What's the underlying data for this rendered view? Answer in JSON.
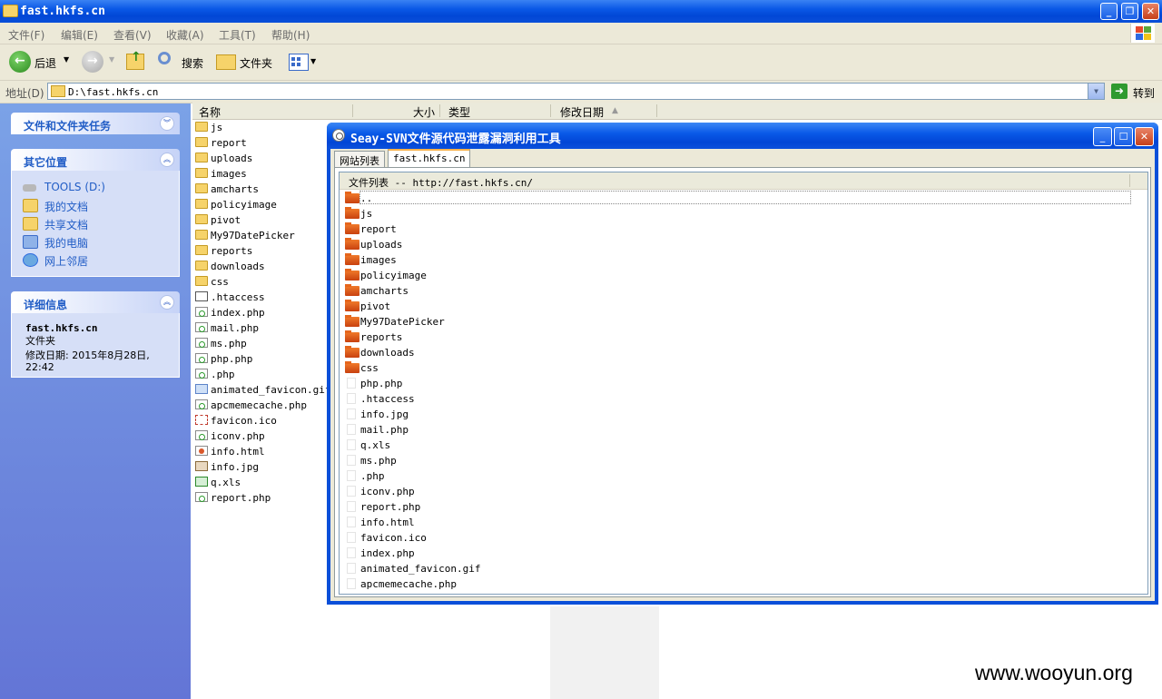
{
  "explorer": {
    "title": "fast.hkfs.cn",
    "menu": [
      "文件(F)",
      "编辑(E)",
      "查看(V)",
      "收藏(A)",
      "工具(T)",
      "帮助(H)"
    ],
    "toolbar": {
      "back": "后退",
      "search": "搜索",
      "folders": "文件夹"
    },
    "address": {
      "label": "地址(D)",
      "path": "D:\\fast.hkfs.cn",
      "go": "转到"
    },
    "columns": {
      "name": "名称",
      "size": "大小",
      "type": "类型",
      "modified": "修改日期"
    },
    "files": [
      {
        "name": "js",
        "icon": "folder-icon"
      },
      {
        "name": "report",
        "icon": "folder-icon"
      },
      {
        "name": "uploads",
        "icon": "folder-icon"
      },
      {
        "name": "images",
        "icon": "folder-icon"
      },
      {
        "name": "amcharts",
        "icon": "folder-icon"
      },
      {
        "name": "policyimage",
        "icon": "folder-icon"
      },
      {
        "name": "pivot",
        "icon": "folder-icon"
      },
      {
        "name": "My97DatePicker",
        "icon": "folder-icon"
      },
      {
        "name": "reports",
        "icon": "folder-icon"
      },
      {
        "name": "downloads",
        "icon": "folder-icon"
      },
      {
        "name": "css",
        "icon": "folder-icon"
      },
      {
        "name": ".htaccess",
        "icon": "htaccess-file-icon"
      },
      {
        "name": "index.php",
        "icon": "php-file-icon"
      },
      {
        "name": "mail.php",
        "icon": "php-file-icon"
      },
      {
        "name": "ms.php",
        "icon": "php-file-icon"
      },
      {
        "name": "php.php",
        "icon": "php-file-icon"
      },
      {
        "name": ".php",
        "icon": "php-file-icon"
      },
      {
        "name": "animated_favicon.gif",
        "icon": "gif-file-icon"
      },
      {
        "name": "apcmemecache.php",
        "icon": "php-file-icon"
      },
      {
        "name": "favicon.ico",
        "icon": "ico-file-icon"
      },
      {
        "name": "iconv.php",
        "icon": "php-file-icon"
      },
      {
        "name": "info.html",
        "icon": "html-file-icon"
      },
      {
        "name": "info.jpg",
        "icon": "jpg-file-icon"
      },
      {
        "name": "q.xls",
        "icon": "xls-file-icon"
      },
      {
        "name": "report.php",
        "icon": "php-file-icon"
      }
    ]
  },
  "taskpane": {
    "file_tasks": {
      "title": "文件和文件夹任务"
    },
    "other_places": {
      "title": "其它位置",
      "items": [
        {
          "label": "TOOLS (D:)",
          "icon": "drive-icon"
        },
        {
          "label": "我的文档",
          "icon": "my-documents-icon"
        },
        {
          "label": "共享文档",
          "icon": "shared-documents-icon"
        },
        {
          "label": "我的电脑",
          "icon": "my-computer-icon"
        },
        {
          "label": "网上邻居",
          "icon": "network-icon"
        }
      ]
    },
    "details": {
      "title": "详细信息",
      "name": "fast.hkfs.cn",
      "type": "文件夹",
      "modified": "修改日期: 2015年8月28日, 22:42"
    }
  },
  "seay": {
    "title": "Seay-SVN文件源代码泄露漏洞利用工具",
    "tabs": [
      "网站列表",
      "fast.hkfs.cn"
    ],
    "list_header": "文件列表 -- http://fast.hkfs.cn/",
    "folders": [
      "..",
      "js",
      "report",
      "uploads",
      "images",
      "policyimage",
      "amcharts",
      "pivot",
      "My97DatePicker",
      "reports",
      "downloads",
      "css"
    ],
    "files": [
      "php.php",
      ".htaccess",
      "info.jpg",
      "mail.php",
      "q.xls",
      "ms.php",
      ".php",
      "iconv.php",
      "report.php",
      "info.html",
      "favicon.ico",
      "index.php",
      "animated_favicon.gif",
      "apcmemecache.php"
    ]
  },
  "watermark": "www.wooyun.org",
  "colors": {
    "xp_blue": "#0a4fd9",
    "taskpane_top": "#7ba2e7",
    "taskpane_bottom": "#6375d6",
    "link_blue": "#215dc6",
    "chrome": "#ece9d8"
  }
}
